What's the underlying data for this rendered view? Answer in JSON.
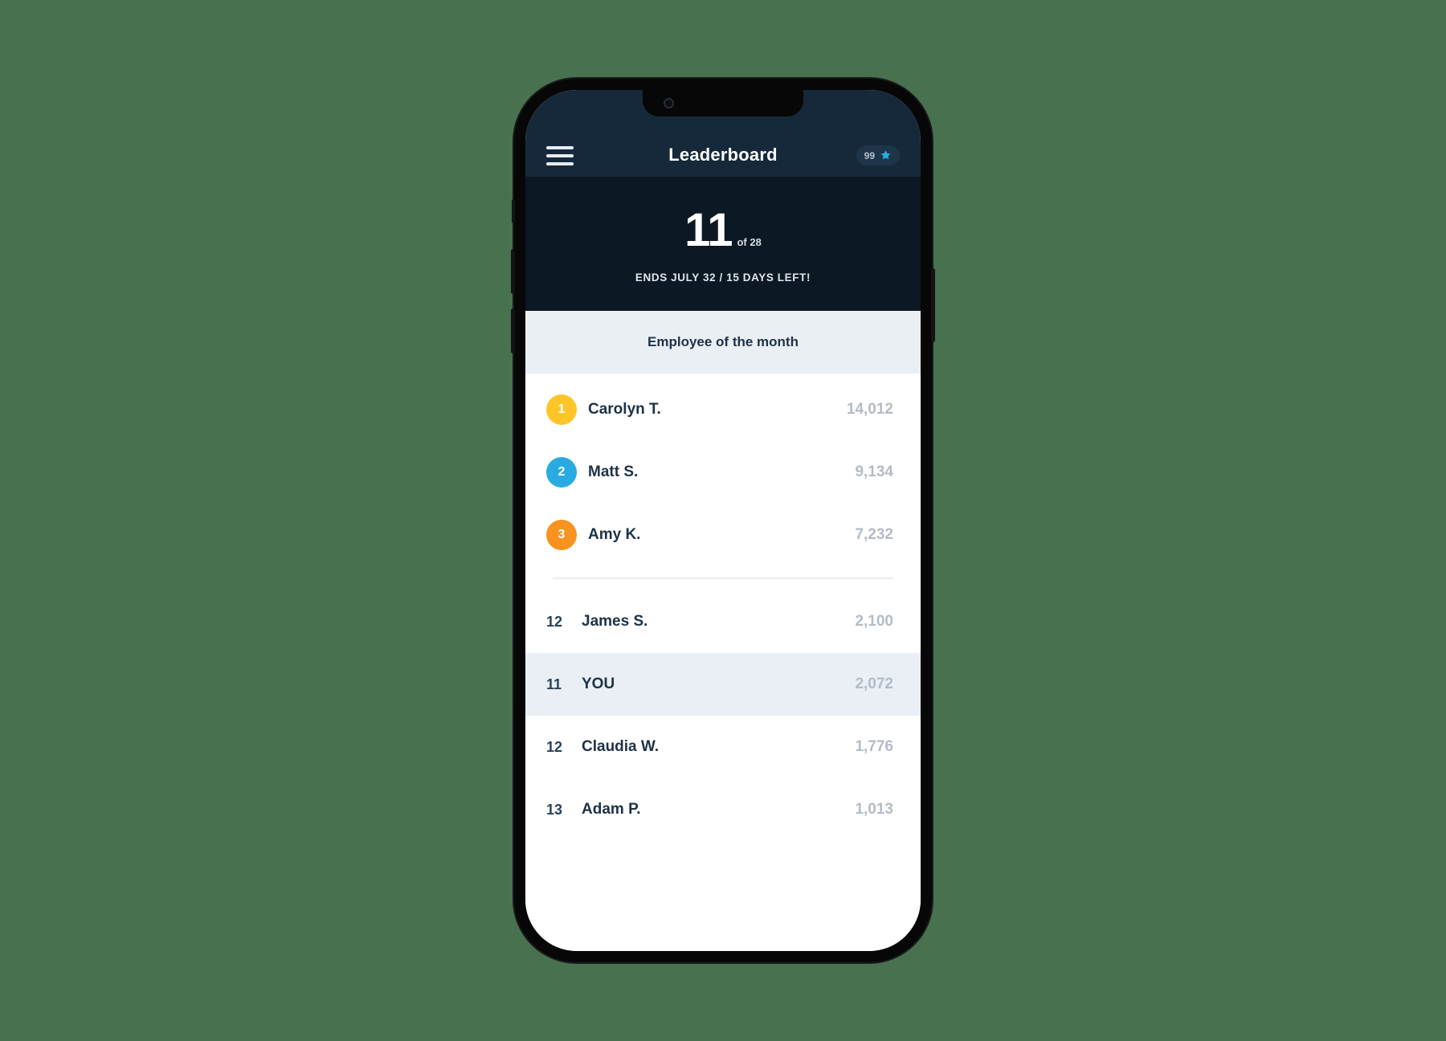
{
  "appbar": {
    "menu_icon": "hamburger-menu-icon",
    "title": "Leaderboard",
    "points_count": "99",
    "points_icon": "star-icon"
  },
  "hero": {
    "rank": "11",
    "rank_of": "of 28",
    "deadline": "ENDS JULY 32 /  15 DAYS LEFT!"
  },
  "section": {
    "title": "Employee of the month"
  },
  "leaderboard": {
    "top": [
      {
        "rank": "1",
        "name": "Carolyn T.",
        "score": "14,012",
        "badge_color": "#FFC428"
      },
      {
        "rank": "2",
        "name": "Matt S.",
        "score": "9,134",
        "badge_color": "#29ABE2"
      },
      {
        "rank": "3",
        "name": "Amy K.",
        "score": "7,232",
        "badge_color": "#F7931E"
      }
    ],
    "near": [
      {
        "rank": "12",
        "name": "James S.",
        "score": "2,100",
        "you": false
      },
      {
        "rank": "11",
        "name": "YOU",
        "score": "2,072",
        "you": true
      },
      {
        "rank": "12",
        "name": "Claudia W.",
        "score": "1,776",
        "you": false
      },
      {
        "rank": "13",
        "name": "Adam P.",
        "score": "1,013",
        "you": false
      }
    ]
  },
  "colors": {
    "page_background": "#47714F",
    "appbar_navy": "#16293B",
    "hero_navy": "#0C1824",
    "section_bg": "#EAEFF4",
    "you_row_bg": "#E9EFF5",
    "text_navy": "#1D3247",
    "score_gray": "#B3BCC6"
  }
}
